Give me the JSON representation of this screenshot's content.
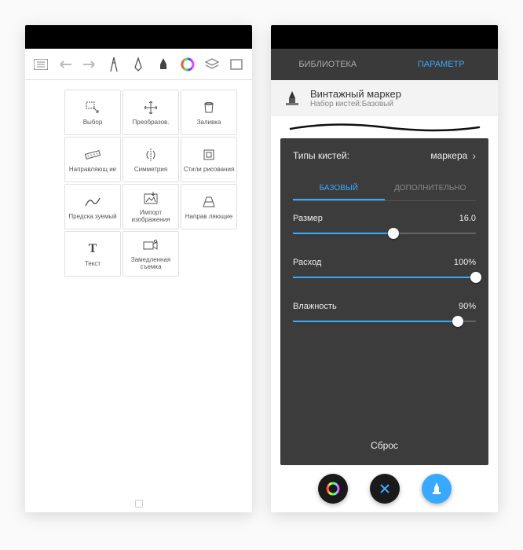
{
  "left": {
    "toolbar_icons": [
      "list",
      "undo",
      "redo",
      "ruler",
      "pen",
      "brush-tip",
      "color",
      "layers",
      "fullscreen"
    ],
    "tools": [
      {
        "icon": "select",
        "label": "Выбор"
      },
      {
        "icon": "move",
        "label": "Преобразов."
      },
      {
        "icon": "bucket",
        "label": "Заливка"
      },
      {
        "icon": "guides",
        "label": "Направляющ\nие"
      },
      {
        "icon": "symmetry",
        "label": "Симметрия"
      },
      {
        "icon": "drawstyle",
        "label": "Стили\nрисования"
      },
      {
        "icon": "curve",
        "label": "Предска\nзуемый"
      },
      {
        "icon": "import",
        "label": "Импорт\nизображения"
      },
      {
        "icon": "perspective",
        "label": "Направ\nляющие"
      },
      {
        "icon": "text",
        "label": "Текст"
      },
      {
        "icon": "timelapse",
        "label": "Замедленная\nсъемка"
      }
    ]
  },
  "right": {
    "tabs": {
      "library": "БИБЛИОТЕКА",
      "params": "ПАРАМЕТР",
      "active": "params"
    },
    "brush": {
      "title": "Винтажный маркер",
      "subtitle": "Набор кистей:Базовый"
    },
    "type_row": {
      "label": "Типы кистей:",
      "value": "маркера"
    },
    "subtabs": {
      "basic": "БАЗОВЫЙ",
      "advanced": "ДОПОЛНИТЕЛЬНО",
      "active": "basic"
    },
    "sliders": [
      {
        "name": "Размер",
        "value": "16.0",
        "pct": 55
      },
      {
        "name": "Расход",
        "value": "100%",
        "pct": 100
      },
      {
        "name": "Влажность",
        "value": "90%",
        "pct": 90
      }
    ],
    "reset": "Сброс"
  }
}
